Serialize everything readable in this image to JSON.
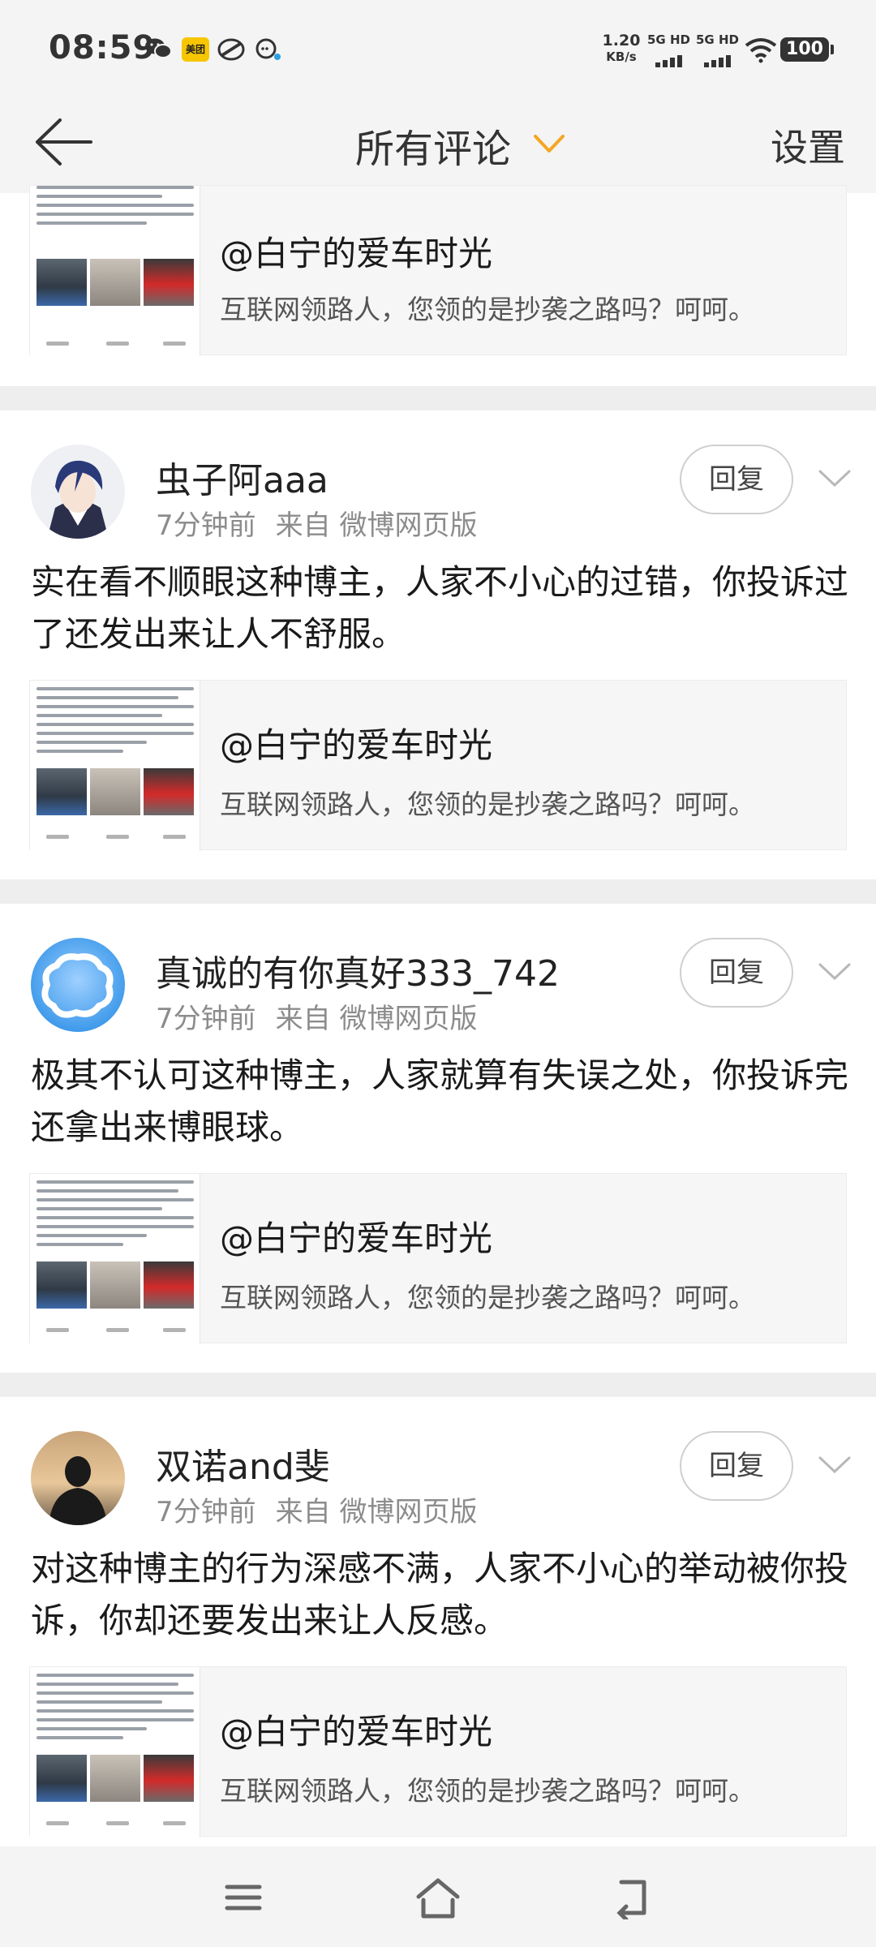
{
  "status_bar": {
    "time": "08:59",
    "meituan_label": "美团",
    "net_speed_value": "1.20",
    "net_speed_unit": "KB/s",
    "signal_1_label": "5G HD",
    "signal_2_label": "5G HD",
    "battery": "100",
    "icons": [
      "wechat-icon",
      "meituan-icon",
      "leaf-app-icon",
      "chat-bubble-icon",
      "wifi-icon",
      "battery-icon"
    ]
  },
  "nav": {
    "title": "所有评论",
    "settings_label": "设置",
    "accent_color": "#f5a623",
    "icons": [
      "back-arrow-icon",
      "dropdown-caret-icon"
    ]
  },
  "quote": {
    "handle": "@白宁的爱车时光",
    "text": "互联网领路人，您领的是抄袭之路吗？呵呵。"
  },
  "reply_label": "回复",
  "comments": [
    {
      "username": "虫子阿aaa",
      "time": "7分钟前",
      "source": "来自 微博网页版",
      "text": "实在看不顺眼这种博主，人家不小心的过错，你投诉过了还发出来让人不舒服。"
    },
    {
      "username": "真诚的有你真好333_742",
      "time": "7分钟前",
      "source": "来自 微博网页版",
      "text": "极其不认可这种博主，人家就算有失误之处，你投诉完还拿出来博眼球。"
    },
    {
      "username": "双诺and斐",
      "time": "7分钟前",
      "source": "来自 微博网页版",
      "text": "对这种博主的行为深感不满，人家不小心的举动被你投诉，你却还要发出来让人反感。"
    }
  ],
  "bottom_nav": {
    "icons": [
      "menu-icon",
      "home-icon",
      "back-icon"
    ]
  }
}
